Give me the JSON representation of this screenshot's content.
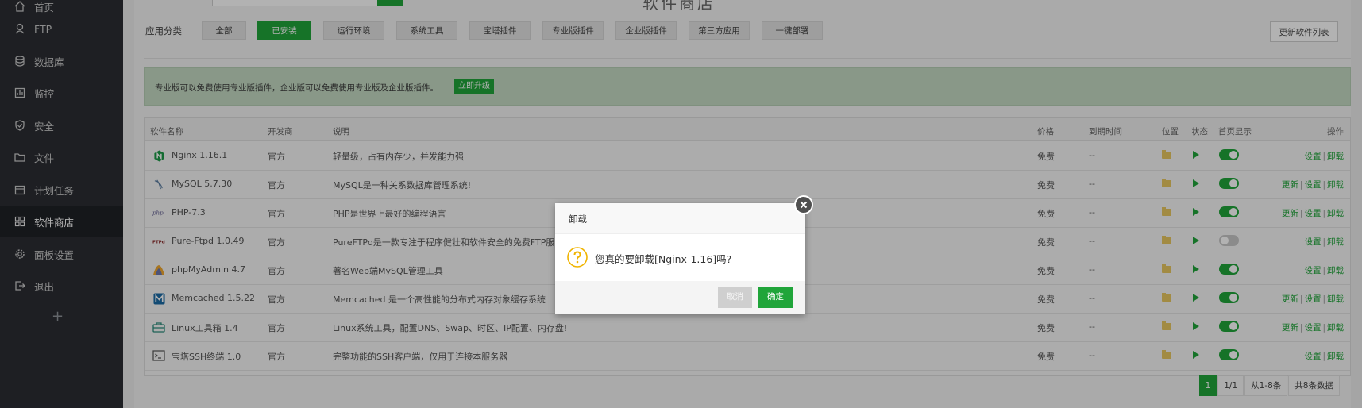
{
  "sidebar": {
    "items": [
      {
        "label": "首页",
        "icon": "home-icon"
      },
      {
        "label": "FTP",
        "icon": "ftp-icon"
      },
      {
        "label": "数据库",
        "icon": "database-icon"
      },
      {
        "label": "监控",
        "icon": "monitor-icon"
      },
      {
        "label": "安全",
        "icon": "shield-icon"
      },
      {
        "label": "文件",
        "icon": "folder-icon"
      },
      {
        "label": "计划任务",
        "icon": "calendar-icon"
      },
      {
        "label": "软件商店",
        "icon": "grid-icon"
      },
      {
        "label": "面板设置",
        "icon": "gear-icon"
      },
      {
        "label": "退出",
        "icon": "logout-icon"
      }
    ],
    "add_label": "+"
  },
  "header": {
    "title": "软件商店"
  },
  "categories": {
    "label": "应用分类",
    "items": [
      "全部",
      "已安装",
      "运行环境",
      "系统工具",
      "宝塔插件",
      "专业版插件",
      "企业版插件",
      "第三方应用",
      "一键部署"
    ],
    "active": "已安装",
    "update_button": "更新软件列表"
  },
  "notice": {
    "text": "专业版可以免费使用专业版插件，企业版可以免费使用专业版及企业版插件。",
    "button": "立即升级"
  },
  "table": {
    "headers": [
      "软件名称",
      "开发商",
      "说明",
      "价格",
      "到期时间",
      "位置",
      "状态",
      "首页显示",
      "操作"
    ],
    "rows": [
      {
        "name": "Nginx 1.16.1",
        "dev": "官方",
        "desc": "轻量级，占有内存少，并发能力强",
        "price": "免费",
        "expire": "--",
        "toggle": true,
        "ops": [
          "设置",
          "卸载"
        ]
      },
      {
        "name": "MySQL 5.7.30",
        "dev": "官方",
        "desc": "MySQL是一种关系数据库管理系统!",
        "price": "免费",
        "expire": "--",
        "toggle": true,
        "ops": [
          "更新",
          "设置",
          "卸载"
        ]
      },
      {
        "name": "PHP-7.3",
        "dev": "官方",
        "desc": "PHP是世界上最好的编程语言",
        "price": "免费",
        "expire": "--",
        "toggle": true,
        "ops": [
          "更新",
          "设置",
          "卸载"
        ]
      },
      {
        "name": "Pure-Ftpd 1.0.49",
        "dev": "官方",
        "desc": "PureFTPd是一款专注于程序健壮和软件安全的免费FTP服务",
        "price": "免费",
        "expire": "--",
        "toggle": false,
        "ops": [
          "设置",
          "卸载"
        ]
      },
      {
        "name": "phpMyAdmin 4.7",
        "dev": "官方",
        "desc": "著名Web端MySQL管理工具",
        "price": "免费",
        "expire": "--",
        "toggle": true,
        "ops": [
          "设置",
          "卸载"
        ]
      },
      {
        "name": "Memcached 1.5.22",
        "dev": "官方",
        "desc": "Memcached 是一个高性能的分布式内存对象缓存系统",
        "price": "免费",
        "expire": "--",
        "toggle": true,
        "ops": [
          "更新",
          "设置",
          "卸载"
        ]
      },
      {
        "name": "Linux工具箱 1.4",
        "dev": "官方",
        "desc": "Linux系统工具，配置DNS、Swap、时区、IP配置、内存盘!",
        "price": "免费",
        "expire": "--",
        "toggle": true,
        "ops": [
          "更新",
          "设置",
          "卸载"
        ]
      },
      {
        "name": "宝塔SSH终端 1.0",
        "dev": "官方",
        "desc": "完整功能的SSH客户端，仅用于连接本服务器",
        "price": "免费",
        "expire": "--",
        "toggle": true,
        "ops": [
          "设置",
          "卸载"
        ]
      }
    ]
  },
  "pagination": {
    "current": "1",
    "pages": "1/1",
    "range": "从1-8条",
    "total": "共8条数据"
  },
  "modal": {
    "title": "卸载",
    "message": "您真的要卸载[Nginx-1.16]吗?",
    "cancel": "取消",
    "confirm": "确定"
  },
  "colors": {
    "accent": "#20a53a",
    "sidebar_bg": "#2b2d33",
    "notice_bg": "#c4dac3"
  }
}
